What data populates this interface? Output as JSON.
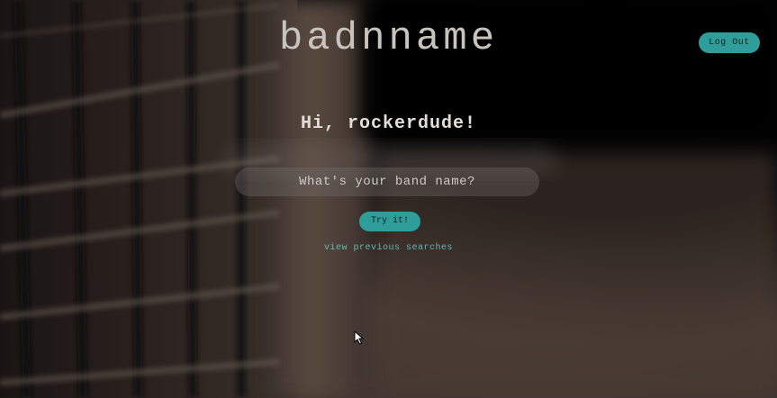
{
  "header": {
    "site_title": "badnname",
    "logout_label": "Log Out"
  },
  "main": {
    "greeting": "Hi, rockerdude!",
    "search": {
      "placeholder": "What's your band name?",
      "value": ""
    },
    "submit_label": "Try it!",
    "previous_link": "view previous searches"
  },
  "colors": {
    "accent": "#2f9e9a",
    "link": "#5fb8b4",
    "title": "#c9c3bd"
  },
  "icons": {
    "cursor": "mouse-pointer-icon",
    "background": "guitar-neck-photo"
  }
}
